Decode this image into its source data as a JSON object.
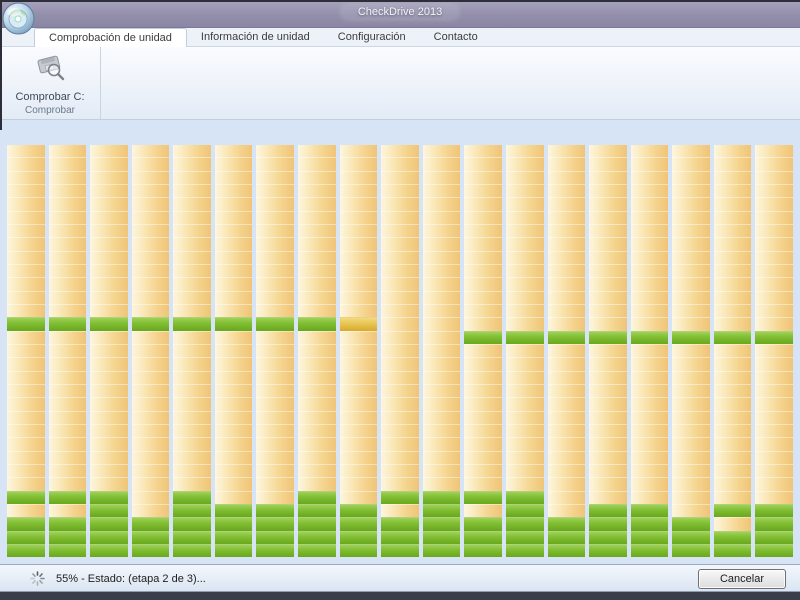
{
  "window": {
    "title": "CheckDrive 2013"
  },
  "tabs": [
    {
      "label": "Comprobación de unidad",
      "active": true
    },
    {
      "label": "Información de unidad",
      "active": false
    },
    {
      "label": "Configuración",
      "active": false
    },
    {
      "label": "Contacto",
      "active": false
    }
  ],
  "ribbon": {
    "button_label": "Comprobar C:",
    "button_icon": "disk-magnifier-icon",
    "group_label": "Comprobar"
  },
  "status_bar": {
    "spinner_icon": "spinner-icon",
    "progress_percent": "55%",
    "progress_text": "55% - Estado: (etapa 2 de 3)...",
    "cancel_label": "Cancelar"
  },
  "colors": {
    "block_unchecked": "#f0c478",
    "block_checked": "#74b427",
    "block_current": "#e0b83c",
    "grid_background": "#d6e4f5",
    "titlebar": "#938fab"
  },
  "block_map": {
    "columns": 19,
    "rows": 31,
    "legend": {
      "o": "unchecked-orange",
      "g": "checked-green",
      "y": "checking-current-yellow"
    },
    "row_states": [
      "ooooooooooooooooooo",
      "ooooooooooooooooooo",
      "ooooooooooooooooooo",
      "ooooooooooooooooooo",
      "ooooooooooooooooooo",
      "ooooooooooooooooooo",
      "ooooooooooooooooooo",
      "ooooooooooooooooooo",
      "ooooooooooooooooooo",
      "ooooooooooooooooooo",
      "ooooooooooooooooooo",
      "ooooooooooooooooooo",
      "ooooooooooooooooooo",
      "ggggggggyoooooooooo",
      "ooooooooooogggggggg",
      "ooooooooooooooooooo",
      "ooooooooooooooooooo",
      "ooooooooooooooooooo",
      "ooooooooooooooooooo",
      "ooooooooooooooooooo",
      "ooooooooooooooooooo",
      "ooooooooooooooooooo",
      "ooooooooooooooooooo",
      "ooooooooooooooooooo",
      "ooooooooooooooooooo",
      "ooooooooooooooooooo",
      "gggogoogoggggoooooo",
      "oogogggggogogoggogg",
      "gggggggggggggggggog",
      "ggggggggggggggggggg",
      "ggggggggggggggggggg"
    ]
  }
}
